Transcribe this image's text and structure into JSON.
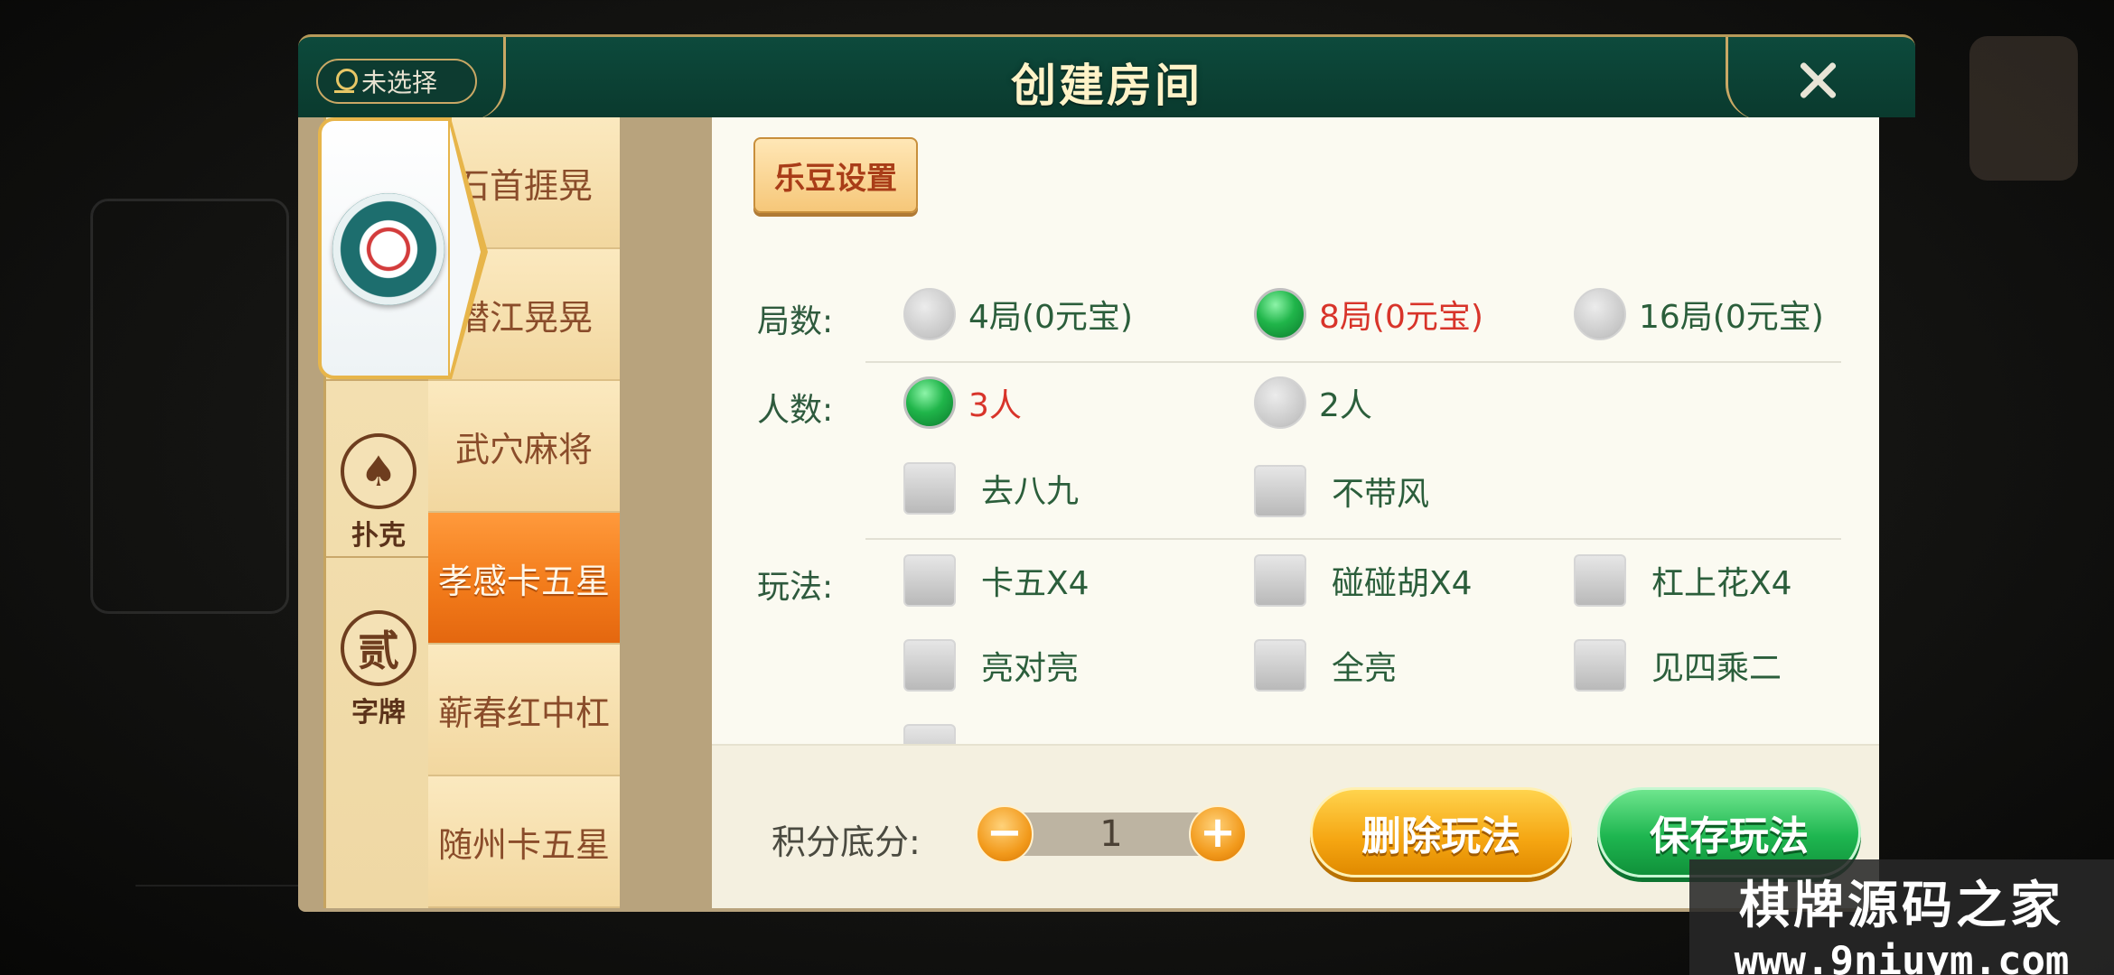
{
  "header": {
    "location_label": "未选择",
    "title": "创建房间"
  },
  "categories": [
    {
      "id": "mahjong",
      "label": "",
      "selected": true
    },
    {
      "id": "poker",
      "label": "扑克",
      "selected": false
    },
    {
      "id": "zipai",
      "label": "字牌",
      "emblem_char": "贰",
      "selected": false
    }
  ],
  "games": [
    {
      "label": "石首捱晃",
      "active": false
    },
    {
      "label": "潜江晃晃",
      "active": false
    },
    {
      "label": "武穴麻将",
      "active": false
    },
    {
      "label": "孝感卡五星",
      "active": true
    },
    {
      "label": "蕲春红中杠",
      "active": false
    },
    {
      "label": "随州卡五星",
      "active": false
    }
  ],
  "content": {
    "bean_settings_label": "乐豆设置",
    "rounds": {
      "label": "局数:",
      "options": [
        {
          "text": "4局(0元宝)",
          "selected": false
        },
        {
          "text": "8局(0元宝)",
          "selected": true
        },
        {
          "text": "16局(0元宝)",
          "selected": false
        }
      ]
    },
    "players": {
      "label": "人数:",
      "options": [
        {
          "text": "3人",
          "selected": true
        },
        {
          "text": "2人",
          "selected": false
        }
      ],
      "extras": [
        {
          "text": "去八九",
          "checked": false
        },
        {
          "text": "不带风",
          "checked": false
        }
      ]
    },
    "rules": {
      "label": "玩法:",
      "options": [
        {
          "text": "卡五X4",
          "checked": false
        },
        {
          "text": "碰碰胡X4",
          "checked": false
        },
        {
          "text": "杠上花X4",
          "checked": false
        },
        {
          "text": "亮对亮",
          "checked": false
        },
        {
          "text": "全亮",
          "checked": false
        },
        {
          "text": "见四乘二",
          "checked": false
        }
      ]
    }
  },
  "bottom": {
    "score_label": "积分底分:",
    "score_value": "1",
    "minus": "−",
    "plus": "+",
    "delete_label": "删除玩法",
    "save_label": "保存玩法"
  },
  "watermark": {
    "line1": "棋牌源码之家",
    "line2": "www.9niuym.com"
  },
  "colors": {
    "header_green": "#0d4a3c",
    "gold_border": "#c9a865",
    "active_orange": "#f37c1b",
    "selected_text_red": "#d8342a",
    "label_green": "#2e5a3d"
  }
}
